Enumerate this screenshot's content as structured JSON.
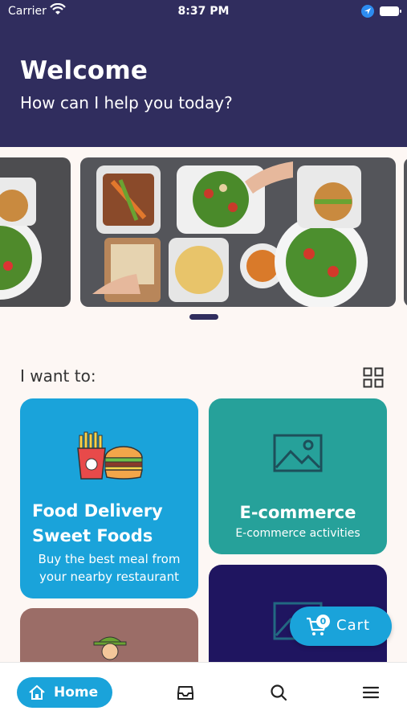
{
  "status_bar": {
    "carrier": "Carrier",
    "time": "8:37 PM"
  },
  "header": {
    "title": "Welcome",
    "subtitle": "How can I help you today?"
  },
  "section": {
    "title": "I want to:"
  },
  "cards": {
    "food": {
      "title_line1": "Food Delivery",
      "title_line2": "Sweet Foods",
      "description": "Buy the best meal from your nearby restaurant"
    },
    "ecommerce": {
      "title": "E-commerce",
      "description": "E-commerce activities"
    }
  },
  "cart": {
    "count": "0",
    "label": "Cart"
  },
  "bottom_nav": {
    "home_label": "Home"
  },
  "colors": {
    "header_bg": "#302d5e",
    "accent": "#1aa3da",
    "ecommerce": "#26a19a",
    "navy_card": "#1f1560",
    "brown_card": "#9b6d67"
  },
  "icons": [
    "wifi-icon",
    "location-icon",
    "battery-icon",
    "grid-view-icon",
    "fries-burger-icon",
    "image-placeholder-icon",
    "delivery-person-icon",
    "cart-icon",
    "home-icon",
    "inbox-icon",
    "search-icon",
    "menu-icon"
  ]
}
